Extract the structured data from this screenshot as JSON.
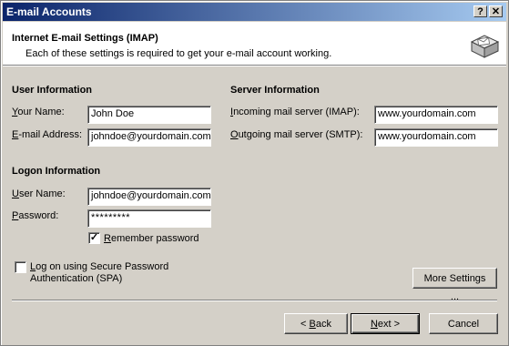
{
  "window": {
    "title": "E-mail Accounts",
    "help_glyph": "?",
    "close_glyph": "✕"
  },
  "header": {
    "title": "Internet E-mail Settings (IMAP)",
    "subtitle": "Each of these settings is required to get your e-mail account working."
  },
  "user_info": {
    "title": "User Information",
    "name_label_key": "Y",
    "name_label_rest": "our Name:",
    "name_value": "John Doe",
    "email_label_key": "E",
    "email_label_rest": "-mail Address:",
    "email_value": "johndoe@yourdomain.com"
  },
  "server_info": {
    "title": "Server Information",
    "incoming_label_key": "I",
    "incoming_label_rest": "ncoming mail server (IMAP):",
    "incoming_value": "www.yourdomain.com",
    "outgoing_label_key": "O",
    "outgoing_label_rest": "utgoing mail server (SMTP):",
    "outgoing_value": "www.yourdomain.com"
  },
  "logon_info": {
    "title": "Logon Information",
    "username_label_key": "U",
    "username_label_rest": "ser Name:",
    "username_value": "johndoe@yourdomain.com",
    "password_label_key": "P",
    "password_label_rest": "assword:",
    "password_value": "*********",
    "remember_key": "R",
    "remember_rest": "emember password",
    "remember_checked": true,
    "remember_mark": "✓"
  },
  "spa": {
    "line1_key": "L",
    "line1_rest": "og on using Secure Password",
    "line2": "Authentication (SPA)",
    "checked": false
  },
  "buttons": {
    "more_settings": "More Settings ...",
    "back_prefix": "< ",
    "back_key": "B",
    "back_rest": "ack",
    "next_key": "N",
    "next_rest": "ext >",
    "cancel": "Cancel"
  }
}
